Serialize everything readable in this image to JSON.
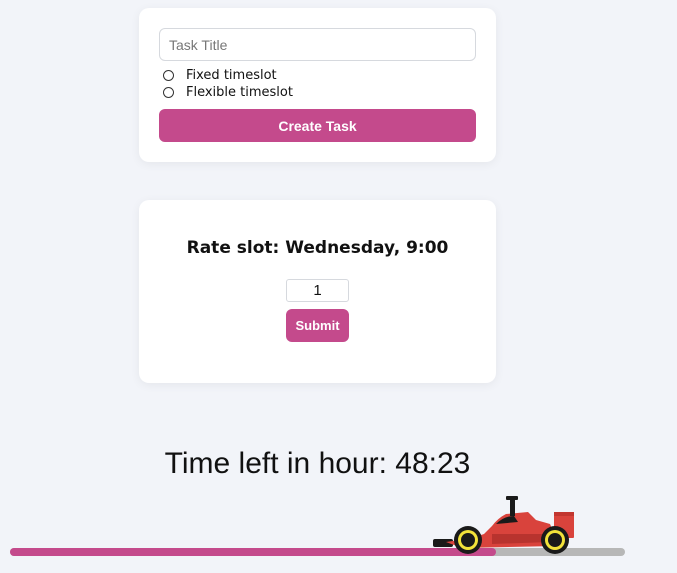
{
  "task_form": {
    "title_placeholder": "Task Title",
    "title_value": "",
    "timeslot_options": [
      "Fixed timeslot",
      "Flexible timeslot"
    ],
    "create_label": "Create Task"
  },
  "rating": {
    "title": "Rate slot: Wednesday, 9:00",
    "value": "1",
    "submit_label": "Submit"
  },
  "timer": {
    "text": "Time left in hour: 48:23",
    "progress_fraction": 0.79
  },
  "colors": {
    "accent": "#c44a8c",
    "track": "#b7b7b7",
    "car_body": "#d9433c",
    "wheel_rim": "#f2e23a"
  }
}
